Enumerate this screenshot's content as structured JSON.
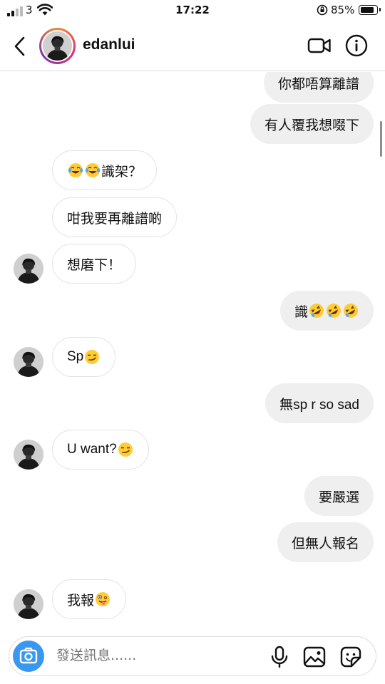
{
  "status_bar": {
    "carrier": "3",
    "time": "17:22",
    "battery_percent": "85%",
    "battery_level": 0.85
  },
  "header": {
    "username": "edanlui"
  },
  "composer": {
    "placeholder": "發送訊息......"
  },
  "messages": [
    {
      "side": "out",
      "parts": [
        {
          "text": "你都唔算離譜"
        }
      ]
    },
    {
      "side": "out",
      "parts": [
        {
          "text": "有人覆我想啜下"
        }
      ]
    },
    {
      "side": "in",
      "parts": [
        {
          "emoji": "laughing-tears"
        },
        {
          "emoji": "laughing-tears"
        },
        {
          "text": "識架？"
        }
      ]
    },
    {
      "side": "in",
      "parts": [
        {
          "text": "咁我要再離譜啲"
        }
      ]
    },
    {
      "side": "in",
      "avatar": true,
      "parts": [
        {
          "text": "想磨下！"
        }
      ]
    },
    {
      "side": "out",
      "parts": [
        {
          "text": "識"
        },
        {
          "emoji": "rofl"
        },
        {
          "emoji": "rofl"
        },
        {
          "emoji": "rofl"
        }
      ]
    },
    {
      "side": "in",
      "avatar": true,
      "parts": [
        {
          "text": "Sp"
        },
        {
          "emoji": "smirk"
        }
      ]
    },
    {
      "side": "out",
      "parts": [
        {
          "text": "無sp r so sad"
        }
      ]
    },
    {
      "side": "in",
      "avatar": true,
      "parts": [
        {
          "text": "U want?"
        },
        {
          "emoji": "smirk"
        }
      ]
    },
    {
      "side": "out",
      "parts": [
        {
          "text": "要嚴選"
        }
      ]
    },
    {
      "side": "out",
      "parts": [
        {
          "text": "但無人報名"
        }
      ]
    },
    {
      "side": "in",
      "avatar": true,
      "parts": [
        {
          "text": "我報"
        },
        {
          "emoji": "zany-face"
        }
      ]
    }
  ]
}
